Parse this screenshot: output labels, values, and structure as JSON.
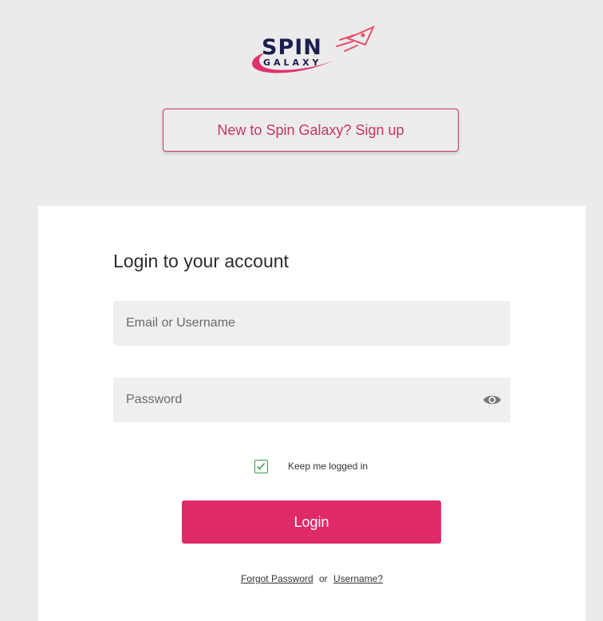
{
  "logo": {
    "word_top": "SPIN",
    "word_bottom": "GALAXY",
    "colors": {
      "dark": "#1c1d4f",
      "pink": "#e0336b"
    }
  },
  "signup": {
    "label": "New to Spin Galaxy? Sign up",
    "color": "#c8365f"
  },
  "login_card": {
    "title": "Login to your account",
    "email": {
      "placeholder": "Email or Username",
      "value": ""
    },
    "password": {
      "placeholder": "Password",
      "value": "",
      "toggle_icon": "eye-icon"
    },
    "remember_me": {
      "label": "Keep me logged in",
      "checked": true,
      "color": "#3a9d4a"
    },
    "login_button": {
      "label": "Login",
      "color": "#de2a66"
    },
    "footer_links": {
      "forgot_password": "Forgot Password",
      "separator": "or",
      "username": "Username?"
    }
  }
}
